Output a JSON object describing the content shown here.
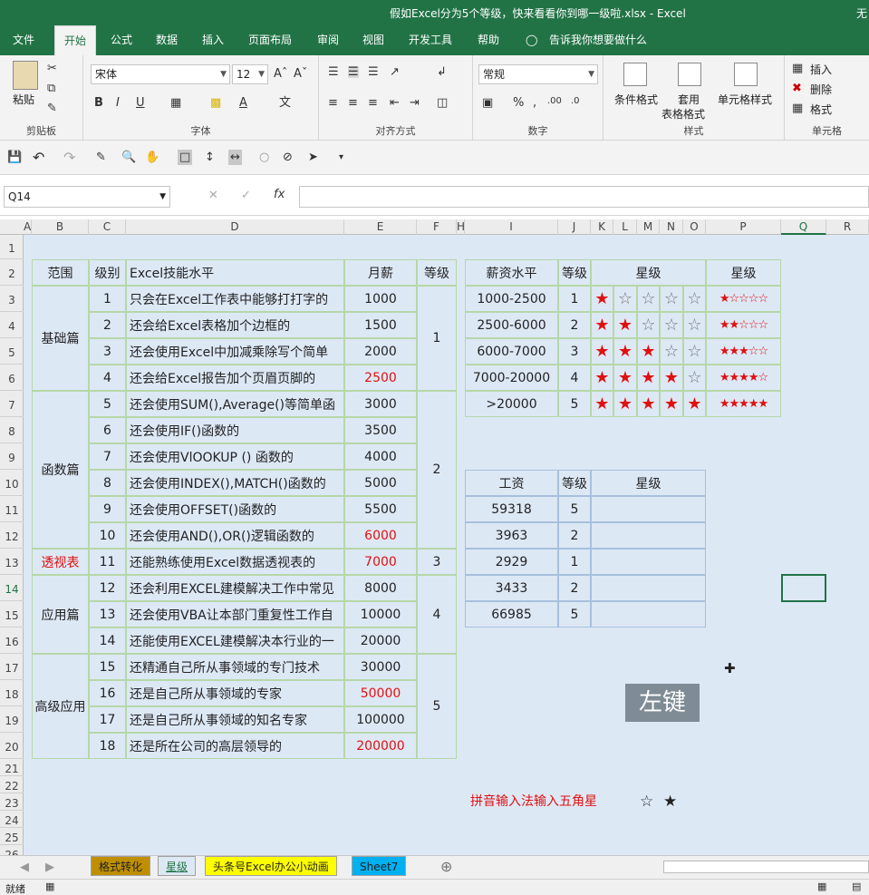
{
  "window": {
    "title": "假如Excel分为5个等级，快来看看你到哪一级啦.xlsx  -  Excel",
    "right_text": "无"
  },
  "tabs": [
    "文件",
    "开始",
    "公式",
    "数据",
    "插入",
    "页面布局",
    "审阅",
    "视图",
    "开发工具",
    "帮助"
  ],
  "tell_me": "告诉我你想要做什么",
  "ribbon": {
    "paste": "粘贴",
    "clipboard": "剪贴板",
    "font_name": "宋体",
    "font_size": "12",
    "font_group": "字体",
    "align_group": "对齐方式",
    "number_format": "常规",
    "number_group": "数字",
    "cond_format": "条件格式",
    "table_format_1": "套用",
    "table_format_2": "表格格式",
    "cell_style": "单元格样式",
    "style_group": "样式",
    "insert": "插入",
    "delete": "删除",
    "format": "格式",
    "cells_group": "单元格"
  },
  "name_box": "Q14",
  "columns": [
    "A",
    "B",
    "C",
    "D",
    "E",
    "F",
    "H",
    "I",
    "J",
    "K",
    "L",
    "M",
    "N",
    "O",
    "P",
    "Q",
    "R"
  ],
  "rows": [
    "1",
    "2",
    "3",
    "4",
    "5",
    "6",
    "7",
    "8",
    "9",
    "10",
    "11",
    "12",
    "13",
    "14",
    "15",
    "16",
    "17",
    "18",
    "19",
    "20",
    "21",
    "22",
    "23",
    "24",
    "25",
    "26"
  ],
  "main_table": {
    "headers": [
      "范围",
      "级别",
      "Excel技能水平",
      "月薪",
      "等级"
    ],
    "sections": [
      {
        "name": "基础篇",
        "grade": "1"
      },
      {
        "name": "函数篇",
        "grade": "2"
      },
      {
        "name": "透视表",
        "grade": "3"
      },
      {
        "name": "应用篇",
        "grade": "4"
      },
      {
        "name": "高级应用",
        "grade": "5"
      }
    ],
    "rows": [
      {
        "n": "1",
        "skill": "只会在Excel工作表中能够打打字的",
        "salary": "1000"
      },
      {
        "n": "2",
        "skill": "还会给Excel表格加个边框的",
        "salary": "1500"
      },
      {
        "n": "3",
        "skill": "还会使用Excel中加减乘除写个简单",
        "salary": "2000"
      },
      {
        "n": "4",
        "skill": "还会给Excel报告加个页眉页脚的",
        "salary": "2500"
      },
      {
        "n": "5",
        "skill": "还会使用SUM(),Average()等简单函",
        "salary": "3000"
      },
      {
        "n": "6",
        "skill": "还会使用IF()函数的",
        "salary": "3500"
      },
      {
        "n": "7",
        "skill": "还会使用VlOOKUP () 函数的",
        "salary": "4000"
      },
      {
        "n": "8",
        "skill": "还会使用INDEX(),MATCH()函数的",
        "salary": "5000"
      },
      {
        "n": "9",
        "skill": "还会使用OFFSET()函数的",
        "salary": "5500"
      },
      {
        "n": "10",
        "skill": "还会使用AND(),OR()逻辑函数的",
        "salary": "6000"
      },
      {
        "n": "11",
        "skill": "还能熟练使用Excel数据透视表的",
        "salary": "7000"
      },
      {
        "n": "12",
        "skill": "还会利用EXCEL建模解决工作中常见",
        "salary": "8000"
      },
      {
        "n": "13",
        "skill": "还会使用VBA让本部门重复性工作自",
        "salary": "10000"
      },
      {
        "n": "14",
        "skill": "还能使用EXCEL建模解决本行业的一",
        "salary": "20000"
      },
      {
        "n": "15",
        "skill": "还精通自己所从事领域的专门技术",
        "salary": "30000"
      },
      {
        "n": "16",
        "skill": "还是自己所从事领域的专家",
        "salary": "50000"
      },
      {
        "n": "17",
        "skill": "还是自己所从事领域的知名专家",
        "salary": "100000"
      },
      {
        "n": "18",
        "skill": "还是所在公司的高层领导的",
        "salary": "200000"
      }
    ]
  },
  "star_table": {
    "headers": [
      "薪资水平",
      "等级",
      "星级",
      "星级"
    ],
    "rows": [
      {
        "range": "1000-2500",
        "grade": "1",
        "stars": "★☆☆☆☆"
      },
      {
        "range": "2500-6000",
        "grade": "2",
        "stars": "★★☆☆☆"
      },
      {
        "range": "6000-7000",
        "grade": "3",
        "stars": "★★★☆☆"
      },
      {
        "range": "7000-20000",
        "grade": "4",
        "stars": "★★★★☆"
      },
      {
        "range": ">20000",
        "grade": "5",
        "stars": "★★★★★"
      }
    ]
  },
  "wage_table": {
    "headers": [
      "工资",
      "等级",
      "星级"
    ],
    "rows": [
      {
        "wage": "59318",
        "grade": "5"
      },
      {
        "wage": "3963",
        "grade": "2"
      },
      {
        "wage": "2929",
        "grade": "1"
      },
      {
        "wage": "3433",
        "grade": "2"
      },
      {
        "wage": "66985",
        "grade": "5"
      }
    ]
  },
  "note": {
    "text": "拼音输入法输入五角星",
    "hollow_star": "☆",
    "solid_star": "★"
  },
  "overlay_badge": "左键",
  "sheet_tabs": [
    "格式转化",
    "星级",
    "头条号Excel办公小动画",
    "Sheet7"
  ],
  "status": "就绪",
  "colors": {
    "green": "#217346",
    "red": "#e01010",
    "cell_bg": "#dde8f5"
  }
}
